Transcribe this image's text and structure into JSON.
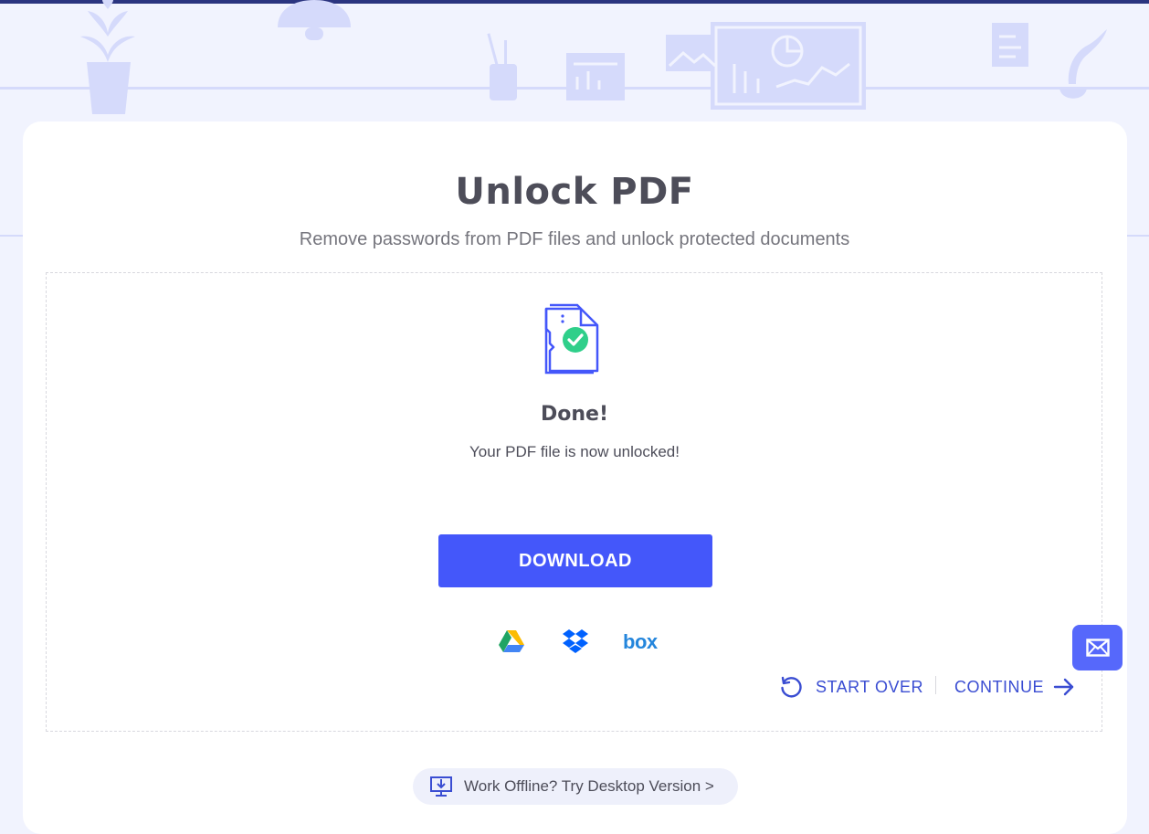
{
  "page": {
    "title": "Unlock PDF",
    "subtitle": "Remove passwords from PDF files and unlock protected documents"
  },
  "result": {
    "heading": "Done!",
    "message": "Your PDF file is now unlocked!",
    "file_icon": "pdf-unlocked-check-icon"
  },
  "actions": {
    "download_label": "DOWNLOAD",
    "save_targets": [
      {
        "name": "Google Drive",
        "icon": "google-drive-icon"
      },
      {
        "name": "Dropbox",
        "icon": "dropbox-icon"
      },
      {
        "name": "box",
        "icon": "box-logo"
      }
    ],
    "start_over_label": "START OVER",
    "continue_label": "CONTINUE"
  },
  "feedback": {
    "icon": "mail-icon"
  },
  "desktop_promo": {
    "label": "Work Offline? Try Desktop Version >",
    "icon": "desktop-download-icon"
  },
  "colors": {
    "accent": "#4457fa",
    "link": "#3a4dd2",
    "background": "#f1f3fe",
    "success": "#2fcf8a"
  }
}
